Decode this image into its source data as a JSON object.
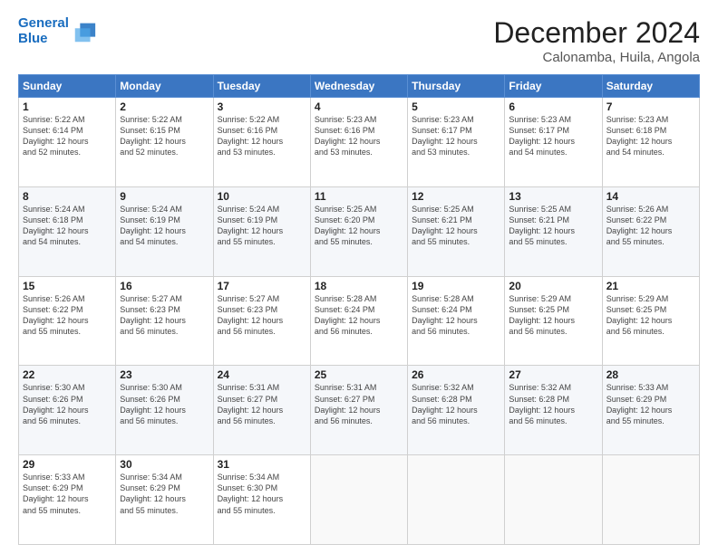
{
  "logo": {
    "line1": "General",
    "line2": "Blue"
  },
  "title": "December 2024",
  "subtitle": "Calonamba, Huila, Angola",
  "header_days": [
    "Sunday",
    "Monday",
    "Tuesday",
    "Wednesday",
    "Thursday",
    "Friday",
    "Saturday"
  ],
  "weeks": [
    [
      {
        "day": "1",
        "info": "Sunrise: 5:22 AM\nSunset: 6:14 PM\nDaylight: 12 hours\nand 52 minutes."
      },
      {
        "day": "2",
        "info": "Sunrise: 5:22 AM\nSunset: 6:15 PM\nDaylight: 12 hours\nand 52 minutes."
      },
      {
        "day": "3",
        "info": "Sunrise: 5:22 AM\nSunset: 6:16 PM\nDaylight: 12 hours\nand 53 minutes."
      },
      {
        "day": "4",
        "info": "Sunrise: 5:23 AM\nSunset: 6:16 PM\nDaylight: 12 hours\nand 53 minutes."
      },
      {
        "day": "5",
        "info": "Sunrise: 5:23 AM\nSunset: 6:17 PM\nDaylight: 12 hours\nand 53 minutes."
      },
      {
        "day": "6",
        "info": "Sunrise: 5:23 AM\nSunset: 6:17 PM\nDaylight: 12 hours\nand 54 minutes."
      },
      {
        "day": "7",
        "info": "Sunrise: 5:23 AM\nSunset: 6:18 PM\nDaylight: 12 hours\nand 54 minutes."
      }
    ],
    [
      {
        "day": "8",
        "info": "Sunrise: 5:24 AM\nSunset: 6:18 PM\nDaylight: 12 hours\nand 54 minutes."
      },
      {
        "day": "9",
        "info": "Sunrise: 5:24 AM\nSunset: 6:19 PM\nDaylight: 12 hours\nand 54 minutes."
      },
      {
        "day": "10",
        "info": "Sunrise: 5:24 AM\nSunset: 6:19 PM\nDaylight: 12 hours\nand 55 minutes."
      },
      {
        "day": "11",
        "info": "Sunrise: 5:25 AM\nSunset: 6:20 PM\nDaylight: 12 hours\nand 55 minutes."
      },
      {
        "day": "12",
        "info": "Sunrise: 5:25 AM\nSunset: 6:21 PM\nDaylight: 12 hours\nand 55 minutes."
      },
      {
        "day": "13",
        "info": "Sunrise: 5:25 AM\nSunset: 6:21 PM\nDaylight: 12 hours\nand 55 minutes."
      },
      {
        "day": "14",
        "info": "Sunrise: 5:26 AM\nSunset: 6:22 PM\nDaylight: 12 hours\nand 55 minutes."
      }
    ],
    [
      {
        "day": "15",
        "info": "Sunrise: 5:26 AM\nSunset: 6:22 PM\nDaylight: 12 hours\nand 55 minutes."
      },
      {
        "day": "16",
        "info": "Sunrise: 5:27 AM\nSunset: 6:23 PM\nDaylight: 12 hours\nand 56 minutes."
      },
      {
        "day": "17",
        "info": "Sunrise: 5:27 AM\nSunset: 6:23 PM\nDaylight: 12 hours\nand 56 minutes."
      },
      {
        "day": "18",
        "info": "Sunrise: 5:28 AM\nSunset: 6:24 PM\nDaylight: 12 hours\nand 56 minutes."
      },
      {
        "day": "19",
        "info": "Sunrise: 5:28 AM\nSunset: 6:24 PM\nDaylight: 12 hours\nand 56 minutes."
      },
      {
        "day": "20",
        "info": "Sunrise: 5:29 AM\nSunset: 6:25 PM\nDaylight: 12 hours\nand 56 minutes."
      },
      {
        "day": "21",
        "info": "Sunrise: 5:29 AM\nSunset: 6:25 PM\nDaylight: 12 hours\nand 56 minutes."
      }
    ],
    [
      {
        "day": "22",
        "info": "Sunrise: 5:30 AM\nSunset: 6:26 PM\nDaylight: 12 hours\nand 56 minutes."
      },
      {
        "day": "23",
        "info": "Sunrise: 5:30 AM\nSunset: 6:26 PM\nDaylight: 12 hours\nand 56 minutes."
      },
      {
        "day": "24",
        "info": "Sunrise: 5:31 AM\nSunset: 6:27 PM\nDaylight: 12 hours\nand 56 minutes."
      },
      {
        "day": "25",
        "info": "Sunrise: 5:31 AM\nSunset: 6:27 PM\nDaylight: 12 hours\nand 56 minutes."
      },
      {
        "day": "26",
        "info": "Sunrise: 5:32 AM\nSunset: 6:28 PM\nDaylight: 12 hours\nand 56 minutes."
      },
      {
        "day": "27",
        "info": "Sunrise: 5:32 AM\nSunset: 6:28 PM\nDaylight: 12 hours\nand 56 minutes."
      },
      {
        "day": "28",
        "info": "Sunrise: 5:33 AM\nSunset: 6:29 PM\nDaylight: 12 hours\nand 55 minutes."
      }
    ],
    [
      {
        "day": "29",
        "info": "Sunrise: 5:33 AM\nSunset: 6:29 PM\nDaylight: 12 hours\nand 55 minutes."
      },
      {
        "day": "30",
        "info": "Sunrise: 5:34 AM\nSunset: 6:29 PM\nDaylight: 12 hours\nand 55 minutes."
      },
      {
        "day": "31",
        "info": "Sunrise: 5:34 AM\nSunset: 6:30 PM\nDaylight: 12 hours\nand 55 minutes."
      },
      null,
      null,
      null,
      null
    ]
  ]
}
